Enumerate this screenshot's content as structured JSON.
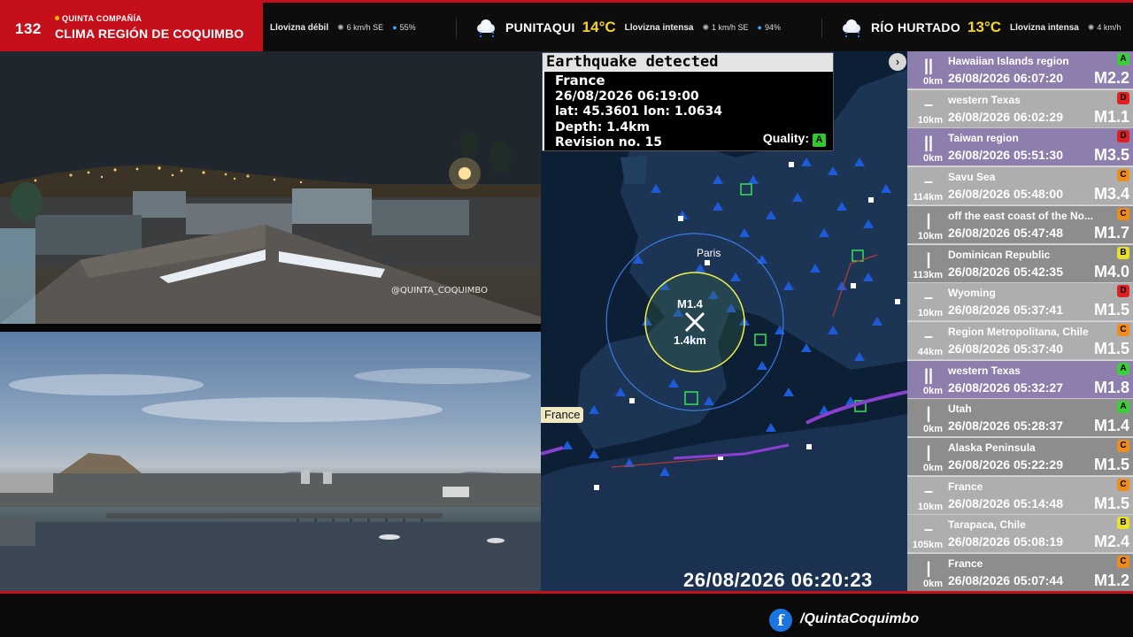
{
  "header": {
    "channel_number": "132",
    "company": "QUINTA COMPAÑÍA",
    "region_title": "CLIMA REGIÓN DE COQUIMBO",
    "locations": [
      {
        "city": "",
        "temp": "",
        "condition": "Llovizna débil",
        "wind": "6 km/h SE",
        "humidity": "55%"
      },
      {
        "city": "PUNITAQUI",
        "temp": "14°C",
        "condition": "Llovizna intensa",
        "wind": "1 km/h SE",
        "humidity": "94%"
      },
      {
        "city": "RÍO HURTADO",
        "temp": "13°C",
        "condition": "Llovizna intensa",
        "wind": "4 km/h",
        "humidity": ""
      }
    ]
  },
  "cameras": {
    "top_watermark": "@QUINTA_COQUIMBO"
  },
  "map": {
    "city_label": "Paris",
    "event_magnitude_label": "M1.4",
    "event_depth_label": "1.4km",
    "location_tag": "France",
    "clock": "26/08/2026 06:20:23",
    "panel": {
      "title": "Earthquake detected",
      "region": "France",
      "datetime": "26/08/2026 06:19:00",
      "coords": "lat: 45.3601 lon: 1.0634",
      "depth": "Depth: 1.4km",
      "revision": "Revision no. 15",
      "quality_label": "Quality:",
      "quality_grade": "A"
    }
  },
  "quake_list": [
    {
      "region": "Hawaiian Islands region",
      "time": "26/08/2026 06:07:20",
      "mag": "M2.2",
      "depth": "0km",
      "grade": "A",
      "grade_color": "#3ccf3c",
      "glyph": "||",
      "style": "hl"
    },
    {
      "region": "western Texas",
      "time": "26/08/2026 06:02:29",
      "mag": "M1.1",
      "depth": "10km",
      "grade": "D",
      "grade_color": "#e02020",
      "glyph": "–",
      "style": "light"
    },
    {
      "region": "Taiwan region",
      "time": "26/08/2026 05:51:30",
      "mag": "M3.5",
      "depth": "0km",
      "grade": "D",
      "grade_color": "#e02020",
      "glyph": "||",
      "style": "hl"
    },
    {
      "region": "Savu Sea",
      "time": "26/08/2026 05:48:00",
      "mag": "M3.4",
      "depth": "114km",
      "grade": "C",
      "grade_color": "#f08c1a",
      "glyph": "–",
      "style": "light"
    },
    {
      "region": "off the east coast of the No...",
      "time": "26/08/2026 05:47:48",
      "mag": "M1.7",
      "depth": "10km",
      "grade": "C",
      "grade_color": "#f08c1a",
      "glyph": "|",
      "style": "dark"
    },
    {
      "region": "Dominican Republic",
      "time": "26/08/2026 05:42:35",
      "mag": "M4.0",
      "depth": "113km",
      "grade": "B",
      "grade_color": "#e8e02a",
      "glyph": "|",
      "style": "dark"
    },
    {
      "region": "Wyoming",
      "time": "26/08/2026 05:37:41",
      "mag": "M1.5",
      "depth": "10km",
      "grade": "D",
      "grade_color": "#e02020",
      "glyph": "–",
      "style": "light"
    },
    {
      "region": "Region Metropolitana, Chile",
      "time": "26/08/2026 05:37:40",
      "mag": "M1.5",
      "depth": "44km",
      "grade": "C",
      "grade_color": "#f08c1a",
      "glyph": "–",
      "style": "light"
    },
    {
      "region": "western Texas",
      "time": "26/08/2026 05:32:27",
      "mag": "M1.8",
      "depth": "0km",
      "grade": "A",
      "grade_color": "#3ccf3c",
      "glyph": "||",
      "style": "hl"
    },
    {
      "region": "Utah",
      "time": "26/08/2026 05:28:37",
      "mag": "M1.4",
      "depth": "0km",
      "grade": "A",
      "grade_color": "#3ccf3c",
      "glyph": "|",
      "style": "dark"
    },
    {
      "region": "Alaska Peninsula",
      "time": "26/08/2026 05:22:29",
      "mag": "M1.5",
      "depth": "0km",
      "grade": "C",
      "grade_color": "#f08c1a",
      "glyph": "|",
      "style": "dark"
    },
    {
      "region": "France",
      "time": "26/08/2026 05:14:48",
      "mag": "M1.5",
      "depth": "10km",
      "grade": "C",
      "grade_color": "#f08c1a",
      "glyph": "–",
      "style": "light"
    },
    {
      "region": "Tarapaca, Chile",
      "time": "26/08/2026 05:08:19",
      "mag": "M2.4",
      "depth": "105km",
      "grade": "B",
      "grade_color": "#e8e02a",
      "glyph": "–",
      "style": "light"
    },
    {
      "region": "France",
      "time": "26/08/2026 05:07:44",
      "mag": "M1.2",
      "depth": "0km",
      "grade": "C",
      "grade_color": "#f08c1a",
      "glyph": "|",
      "style": "dark"
    }
  ],
  "footer": {
    "social_icon": "facebook-icon",
    "social_handle": "/QuintaCoquimbo"
  }
}
